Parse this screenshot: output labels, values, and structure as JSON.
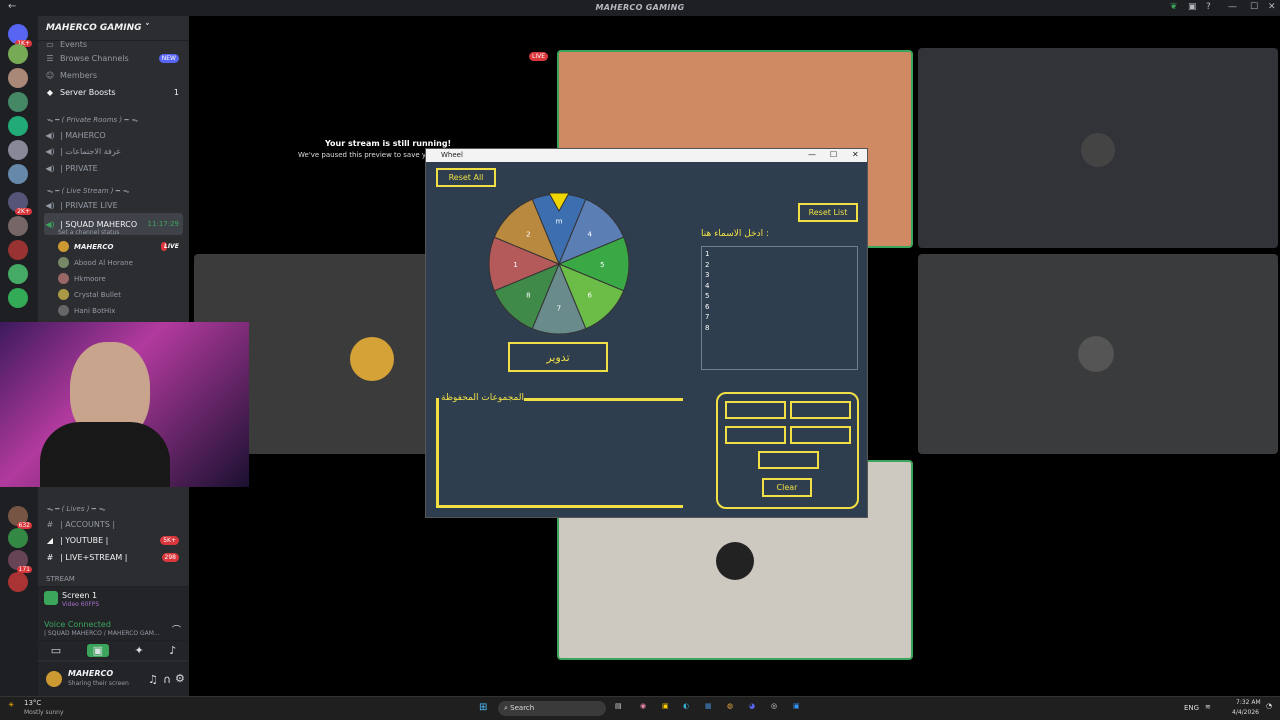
{
  "window": {
    "title": "MAHERCO GAMING"
  },
  "server": {
    "name": "MAHERCO GAMING"
  },
  "channels": {
    "events": "Events",
    "browse": "Browse Channels",
    "browse_badge": "NEW",
    "members": "Members",
    "boosts": "Server Boosts",
    "boosts_count": "1",
    "cat_private": "ᯓ ━ ( Private Rooms ) ━ ᯓ",
    "private_1": "| MAHERCO",
    "private_2": "| غرفة الاجتماعات",
    "private_3": "| PRIVATE",
    "cat_live": "ᯓ ━ ( Live Stream ) ━ ᯓ",
    "live_1": "| PRIVATE LIVE",
    "live_2": "| SQUAD MAHERCO",
    "live_2_time": "11:17:29",
    "channel_status": "Set a channel status",
    "users": [
      "MAHERCO",
      "Abood Al Horane",
      "Hkmoore",
      "Crystal Bullet",
      "Hani BotHix"
    ],
    "live_badge": "LIVE",
    "cat_lives": "ᯓ ━ ( Lives ) ━ ᯓ",
    "text_1": "| ACCOUNTS |",
    "text_2": "| YOUTUBE |",
    "text_2_badge": "5K+",
    "text_3": "| LIVE+STREAM |",
    "text_3_badge": "298",
    "cat_stream": "STREAM"
  },
  "voice": {
    "screen": "Screen 1",
    "screen_sub": "Video 60FPS",
    "connected": "Voice Connected",
    "channel": "| SQUAD MAHERCO / MAHERCO GAM...",
    "user": "MAHERCO",
    "user_status": "Sharing their screen"
  },
  "stream": {
    "live": "LIVE",
    "running": "Your stream is still running!",
    "paused": "We've paused this preview to save your re"
  },
  "wheel_app": {
    "title": "Wheel",
    "reset_all": "Reset All",
    "reset_list": "Reset List",
    "spin": "تدوير",
    "names_label": "ادخل الاسماء هنا :",
    "names": [
      "1",
      "2",
      "3",
      "4",
      "5",
      "6",
      "7",
      "8"
    ],
    "groups_label": "المجموعات المحفوظة",
    "clear": "Clear",
    "segments": [
      {
        "label": "m",
        "color": "#3d6fb0"
      },
      {
        "label": "4",
        "color": "#5b7fb5"
      },
      {
        "label": "5",
        "color": "#3aa845"
      },
      {
        "label": "6",
        "color": "#6bbd48"
      },
      {
        "label": "7",
        "color": "#6a8b8b"
      },
      {
        "label": "8",
        "color": "#3f8a48"
      },
      {
        "label": "1",
        "color": "#b55a5a"
      },
      {
        "label": "2",
        "color": "#b9893f"
      }
    ]
  },
  "taskbar": {
    "weather_temp": "13°C",
    "weather_desc": "Mostly sunny",
    "search": "Search",
    "lang": "ENG",
    "time": "7:32 AM",
    "date": "4/4/2026"
  }
}
